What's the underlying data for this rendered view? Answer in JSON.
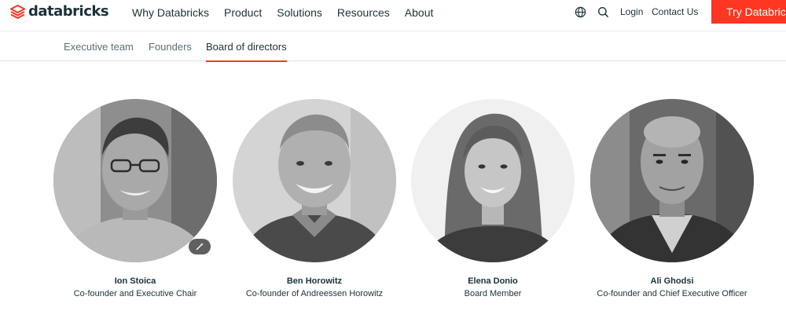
{
  "brand": {
    "name": "databricks",
    "accent": "#ff3621",
    "text_color": "#1b3139"
  },
  "nav": {
    "items": [
      {
        "label": "Why Databricks"
      },
      {
        "label": "Product"
      },
      {
        "label": "Solutions"
      },
      {
        "label": "Resources"
      },
      {
        "label": "About"
      }
    ],
    "language_icon": "globe-icon",
    "search_icon": "search-icon",
    "login": "Login",
    "contact": "Contact Us",
    "cta": "Try Databricks"
  },
  "subnav": {
    "tabs": [
      {
        "label": "Executive team",
        "active": false
      },
      {
        "label": "Founders",
        "active": false
      },
      {
        "label": "Board of directors",
        "active": true
      }
    ]
  },
  "people": [
    {
      "name": "Ion Stoica",
      "role": "Co-founder and Executive Chair"
    },
    {
      "name": "Ben Horowitz",
      "role": "Co-founder of Andreessen Horowitz"
    },
    {
      "name": "Elena Donio",
      "role": "Board Member"
    },
    {
      "name": "Ali Ghodsi",
      "role": "Co-founder and Chief Executive Officer"
    }
  ],
  "overlay_badge_icon": "magic-wand-icon"
}
